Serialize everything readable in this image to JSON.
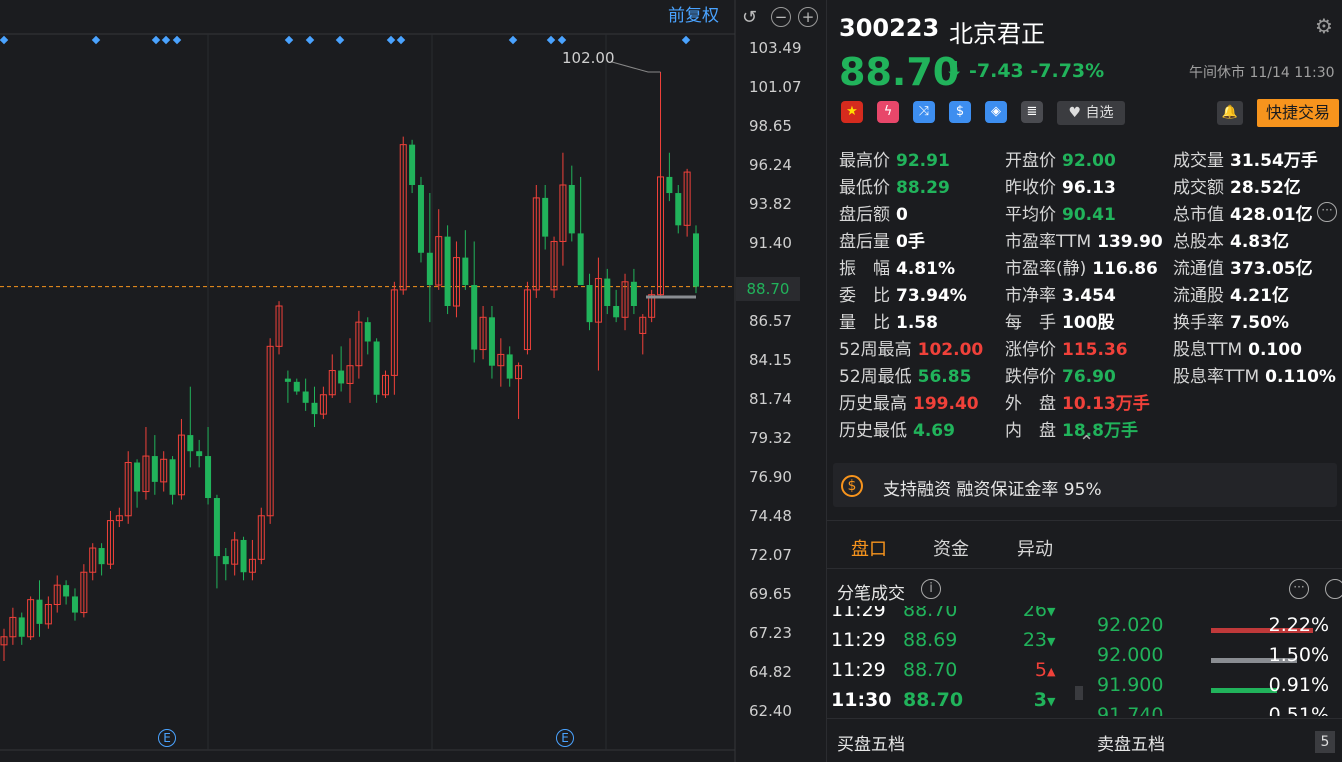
{
  "chart": {
    "adjust_label": "前复权",
    "peak_label": "102.00",
    "current_price_tag": "88.70",
    "y_ticks": [
      "103.49",
      "101.07",
      "98.65",
      "96.24",
      "93.82",
      "91.40",
      "88.70",
      "86.57",
      "84.15",
      "81.74",
      "79.32",
      "76.90",
      "74.48",
      "72.07",
      "69.65",
      "67.23",
      "64.82",
      "62.40"
    ],
    "event_badge": "E",
    "colors": {
      "up": "#f0413a",
      "down": "#21b35b",
      "grid": "#2a2b2f",
      "accent": "#4aa3ff",
      "price_line": "#f7941d"
    }
  },
  "chart_data": {
    "type": "candlestick",
    "ylim": [
      62.4,
      103.49
    ],
    "peak_annotation": 102.0,
    "last_price": 88.7,
    "candles": [
      [
        66.5,
        67.5,
        65.5,
        67.0
      ],
      [
        67.0,
        68.8,
        66.5,
        68.2
      ],
      [
        68.2,
        68.5,
        66.5,
        67.0
      ],
      [
        67.0,
        69.5,
        66.8,
        69.3
      ],
      [
        69.3,
        70.5,
        67.0,
        67.8
      ],
      [
        67.8,
        69.5,
        67.5,
        69.0
      ],
      [
        69.0,
        70.8,
        68.5,
        70.2
      ],
      [
        70.2,
        70.5,
        69.0,
        69.5
      ],
      [
        69.5,
        70.0,
        68.0,
        68.5
      ],
      [
        68.5,
        71.5,
        68.2,
        71.0
      ],
      [
        71.0,
        72.8,
        70.5,
        72.5
      ],
      [
        72.5,
        72.8,
        70.8,
        71.5
      ],
      [
        71.5,
        74.8,
        71.2,
        74.2
      ],
      [
        74.2,
        75.0,
        73.8,
        74.5
      ],
      [
        74.5,
        78.5,
        74.0,
        77.8
      ],
      [
        77.8,
        78.0,
        75.0,
        76.0
      ],
      [
        76.0,
        80.0,
        75.5,
        78.2
      ],
      [
        78.2,
        79.5,
        75.8,
        76.6
      ],
      [
        76.6,
        78.5,
        76.0,
        78.0
      ],
      [
        78.0,
        78.2,
        75.2,
        75.8
      ],
      [
        75.8,
        80.5,
        75.5,
        79.5
      ],
      [
        79.5,
        82.5,
        77.5,
        78.5
      ],
      [
        78.5,
        79.2,
        77.5,
        78.2
      ],
      [
        78.2,
        80.0,
        75.2,
        75.6
      ],
      [
        75.6,
        75.8,
        70.0,
        72.0
      ],
      [
        72.0,
        72.5,
        70.5,
        71.5
      ],
      [
        71.5,
        73.5,
        70.8,
        73.0
      ],
      [
        73.0,
        73.2,
        70.5,
        71.0
      ],
      [
        71.0,
        73.0,
        70.5,
        71.8
      ],
      [
        71.8,
        75.0,
        71.5,
        74.5
      ],
      [
        74.5,
        85.5,
        74.0,
        85.0
      ],
      [
        85.0,
        87.8,
        84.5,
        87.5
      ],
      [
        83.0,
        83.5,
        81.5,
        82.8
      ],
      [
        82.8,
        83.0,
        82.0,
        82.2
      ],
      [
        82.2,
        83.0,
        81.0,
        81.5
      ],
      [
        81.5,
        82.5,
        80.0,
        80.8
      ],
      [
        80.8,
        82.5,
        80.5,
        82.0
      ],
      [
        82.0,
        84.5,
        81.8,
        83.5
      ],
      [
        83.5,
        85.0,
        82.2,
        82.7
      ],
      [
        82.7,
        85.5,
        81.5,
        83.8
      ],
      [
        83.8,
        87.2,
        83.0,
        86.5
      ],
      [
        86.5,
        86.8,
        84.5,
        85.3
      ],
      [
        85.3,
        85.5,
        81.5,
        82.0
      ],
      [
        82.0,
        83.5,
        81.8,
        83.2
      ],
      [
        83.2,
        89.0,
        82.0,
        88.5
      ],
      [
        88.5,
        98.0,
        88.2,
        97.5
      ],
      [
        97.5,
        97.8,
        94.5,
        95.0
      ],
      [
        95.0,
        95.5,
        90.2,
        90.8
      ],
      [
        90.8,
        94.5,
        86.5,
        88.8
      ],
      [
        88.8,
        93.5,
        88.5,
        91.8
      ],
      [
        91.8,
        92.5,
        87.0,
        87.5
      ],
      [
        87.5,
        91.5,
        86.8,
        90.5
      ],
      [
        90.5,
        92.2,
        88.5,
        88.8
      ],
      [
        88.8,
        91.5,
        84.0,
        84.8
      ],
      [
        84.8,
        87.5,
        84.2,
        86.8
      ],
      [
        86.8,
        87.5,
        83.0,
        83.8
      ],
      [
        83.8,
        85.5,
        82.5,
        84.5
      ],
      [
        84.5,
        85.0,
        82.5,
        83.0
      ],
      [
        83.0,
        84.0,
        80.5,
        83.8
      ],
      [
        84.8,
        89.0,
        84.5,
        88.5
      ],
      [
        88.5,
        95.0,
        88.0,
        94.2
      ],
      [
        94.2,
        95.0,
        91.0,
        91.8
      ],
      [
        88.5,
        91.8,
        88.0,
        91.5
      ],
      [
        91.5,
        97.0,
        90.0,
        95.0
      ],
      [
        95.0,
        96.2,
        91.5,
        92.0
      ],
      [
        92.0,
        95.5,
        89.2,
        88.8
      ],
      [
        88.8,
        89.5,
        86.0,
        86.5
      ],
      [
        86.5,
        90.5,
        83.5,
        89.2
      ],
      [
        89.2,
        89.8,
        87.0,
        87.5
      ],
      [
        87.5,
        88.5,
        86.5,
        86.8
      ],
      [
        86.8,
        89.5,
        86.0,
        89.0
      ],
      [
        89.0,
        89.8,
        87.0,
        87.5
      ],
      [
        85.8,
        87.0,
        84.5,
        86.8
      ],
      [
        86.8,
        88.5,
        86.5,
        88.2
      ],
      [
        88.2,
        102.0,
        88.0,
        95.5
      ],
      [
        95.5,
        97.0,
        94.0,
        94.5
      ],
      [
        94.5,
        95.0,
        92.0,
        92.5
      ],
      [
        92.5,
        96.0,
        91.8,
        95.8
      ],
      [
        92.0,
        92.5,
        88.3,
        88.7
      ]
    ]
  },
  "quote": {
    "code": "300223",
    "name": "北京君正",
    "price": "88.70",
    "change": "-7.43",
    "change_pct": "-7.73%",
    "status": "午间休市 11/14 11:30",
    "watch_label": "自选",
    "quick_trade_label": "快捷交易",
    "fields": [
      {
        "label": "最高价",
        "value": "92.91",
        "color": "green"
      },
      {
        "label": "开盘价",
        "value": "92.00",
        "color": "green"
      },
      {
        "label": "成交量",
        "value": "31.54万手",
        "color": "white"
      },
      {
        "label": "最低价",
        "value": "88.29",
        "color": "green"
      },
      {
        "label": "昨收价",
        "value": "96.13",
        "color": "white"
      },
      {
        "label": "成交额",
        "value": "28.52亿",
        "color": "white"
      },
      {
        "label": "盘后额",
        "value": "0",
        "color": "white"
      },
      {
        "label": "平均价",
        "value": "90.41",
        "color": "green"
      },
      {
        "label": "总市值",
        "value": "428.01亿",
        "color": "white"
      },
      {
        "label": "盘后量",
        "value": "0手",
        "color": "white"
      },
      {
        "label": "市盈率TTM",
        "value": "139.90",
        "color": "white"
      },
      {
        "label": "总股本",
        "value": "4.83亿",
        "color": "white"
      },
      {
        "label": "振　幅",
        "value": "4.81%",
        "color": "white"
      },
      {
        "label": "市盈率(静)",
        "value": "116.86",
        "color": "white"
      },
      {
        "label": "流通值",
        "value": "373.05亿",
        "color": "white"
      },
      {
        "label": "委　比",
        "value": "73.94%",
        "color": "white"
      },
      {
        "label": "市净率",
        "value": "3.454",
        "color": "white"
      },
      {
        "label": "流通股",
        "value": "4.21亿",
        "color": "white"
      },
      {
        "label": "量　比",
        "value": "1.58",
        "color": "white"
      },
      {
        "label": "每　手",
        "value": "100股",
        "color": "white"
      },
      {
        "label": "换手率",
        "value": "7.50%",
        "color": "white"
      },
      {
        "label": "52周最高",
        "value": "102.00",
        "color": "red"
      },
      {
        "label": "涨停价",
        "value": "115.36",
        "color": "red"
      },
      {
        "label": "股息TTM",
        "value": "0.100",
        "color": "white"
      },
      {
        "label": "52周最低",
        "value": "56.85",
        "color": "green"
      },
      {
        "label": "跌停价",
        "value": "76.90",
        "color": "green"
      },
      {
        "label": "股息率TTM",
        "value": "0.110%",
        "color": "white"
      },
      {
        "label": "历史最高",
        "value": "199.40",
        "color": "red"
      },
      {
        "label": "外　盘",
        "value": "10.13万手",
        "color": "red"
      },
      {
        "label": "",
        "value": "",
        "color": "white"
      },
      {
        "label": "历史最低",
        "value": "4.69",
        "color": "green"
      },
      {
        "label": "内　盘",
        "value": "18.8万手",
        "color": "green"
      },
      {
        "label": "",
        "value": "",
        "color": "white"
      }
    ],
    "margin_text": "支持融资 融资保证金率 95%",
    "tabs": [
      "盘口",
      "资金",
      "异动"
    ],
    "ticks_title": "分笔成交",
    "ticks": [
      {
        "time": "11:29",
        "price": "88.70",
        "vol": "26",
        "dir": "down"
      },
      {
        "time": "11:29",
        "price": "88.69",
        "vol": "23",
        "dir": "down"
      },
      {
        "time": "11:29",
        "price": "88.70",
        "vol": "5",
        "dir": "up"
      },
      {
        "time": "11:30",
        "price": "88.70",
        "vol": "3",
        "dir": "down"
      }
    ],
    "orderbook": [
      {
        "price": "92.020",
        "pct": "2.22%",
        "bar": 0.85,
        "color": "#c0393a"
      },
      {
        "price": "92.000",
        "pct": "1.50%",
        "bar": 0.72,
        "color": "#8a8d92"
      },
      {
        "price": "91.900",
        "pct": "0.91%",
        "bar": 0.55,
        "color": "#21b35b"
      },
      {
        "price": "91.740",
        "pct": "0.51%",
        "bar": 0.18,
        "color": "#c0393a"
      }
    ],
    "bid_label": "买盘五档",
    "ask_label": "卖盘五档",
    "levels_badge": "5"
  }
}
